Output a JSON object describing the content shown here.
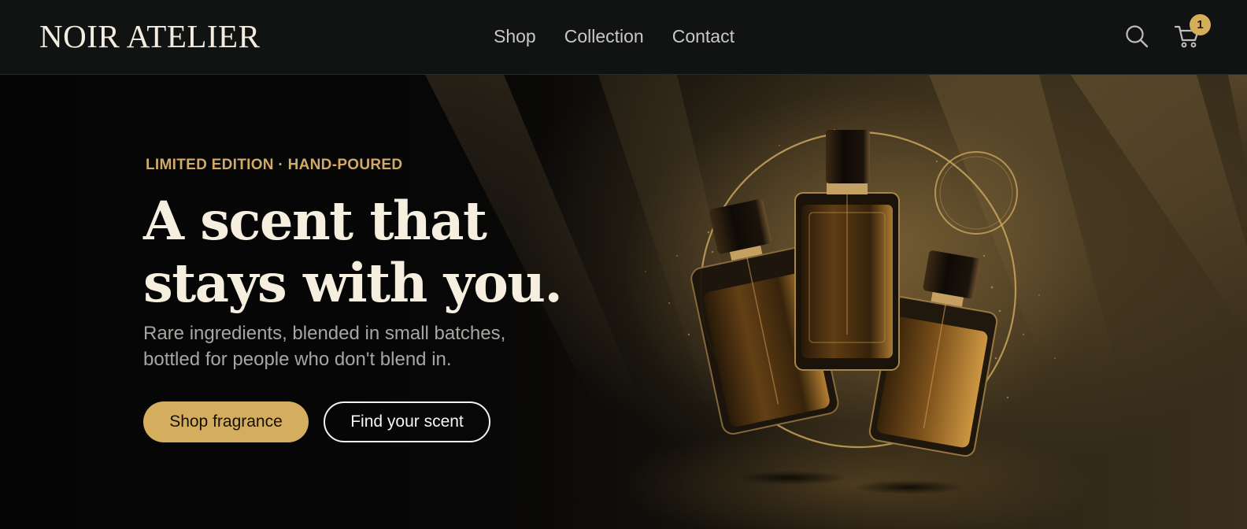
{
  "header": {
    "logo": "NOIR ATELIER",
    "nav": [
      "Shop",
      "Collection",
      "Contact"
    ],
    "search_icon": "search-icon",
    "cart_icon": "cart-icon",
    "cart_count": "1"
  },
  "hero": {
    "eyebrow": "LIMITED EDITION · HAND-POURED",
    "headline_line1": "A scent that",
    "headline_line2": "stays with you.",
    "subcopy_line1": "Rare ingredients, blended in small batches,",
    "subcopy_line2": "bottled for people who don't blend in.",
    "primary_cta": "Shop fragrance",
    "secondary_cta": "Find your scent",
    "image": "three-perfume-bottles-with-gold-rings"
  },
  "colors": {
    "header_bg": "#111212",
    "hero_bg": "#070707",
    "accent_gold": "#d4ae5e",
    "eyebrow_gold": "#d0aa66",
    "headline": "#f6efdf",
    "subcopy": "#a8a6a2"
  }
}
